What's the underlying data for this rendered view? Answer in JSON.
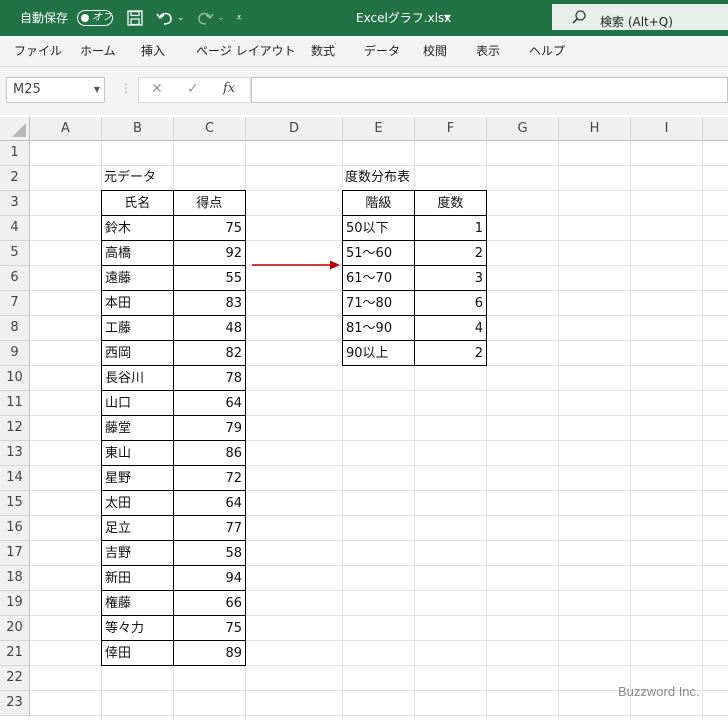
{
  "titlebar": {
    "autosave_label": "自動保存",
    "autosave_state": "オフ",
    "filename": "Excelグラフ.xlsx",
    "search_label": "検索 (Alt+Q)"
  },
  "menu": [
    "ファイル",
    "ホーム",
    "挿入",
    "ページ レイアウト",
    "数式",
    "データ",
    "校閲",
    "表示",
    "ヘルプ"
  ],
  "formula_bar": {
    "name_box": "M25",
    "cancel": "✕",
    "enter": "✓",
    "fx": "fx",
    "content": ""
  },
  "columns": [
    "A",
    "B",
    "C",
    "D",
    "E",
    "F",
    "G",
    "H",
    "I"
  ],
  "rows": [
    "1",
    "2",
    "3",
    "4",
    "5",
    "6",
    "7",
    "8",
    "9",
    "10",
    "11",
    "12",
    "13",
    "14",
    "15",
    "16",
    "17",
    "18",
    "19",
    "20",
    "21",
    "22",
    "23"
  ],
  "source": {
    "title": "元データ",
    "headers": [
      "氏名",
      "得点"
    ],
    "rows": [
      [
        "鈴木",
        "75"
      ],
      [
        "高橋",
        "92"
      ],
      [
        "遠藤",
        "55"
      ],
      [
        "本田",
        "83"
      ],
      [
        "工藤",
        "48"
      ],
      [
        "西岡",
        "82"
      ],
      [
        "長谷川",
        "78"
      ],
      [
        "山口",
        "64"
      ],
      [
        "藤堂",
        "79"
      ],
      [
        "東山",
        "86"
      ],
      [
        "星野",
        "72"
      ],
      [
        "太田",
        "64"
      ],
      [
        "足立",
        "77"
      ],
      [
        "吉野",
        "58"
      ],
      [
        "新田",
        "94"
      ],
      [
        "権藤",
        "66"
      ],
      [
        "等々力",
        "75"
      ],
      [
        "倖田",
        "89"
      ]
    ]
  },
  "freq": {
    "title": "度数分布表",
    "headers": [
      "階級",
      "度数"
    ],
    "rows": [
      [
        "50以下",
        "1"
      ],
      [
        "51～60",
        "2"
      ],
      [
        "61～70",
        "3"
      ],
      [
        "71～80",
        "6"
      ],
      [
        "81～90",
        "4"
      ],
      [
        "90以上",
        "2"
      ]
    ]
  },
  "colors": {
    "title_green": "#217346",
    "arrow": "#c00000"
  },
  "watermark": "Buzzword Inc."
}
